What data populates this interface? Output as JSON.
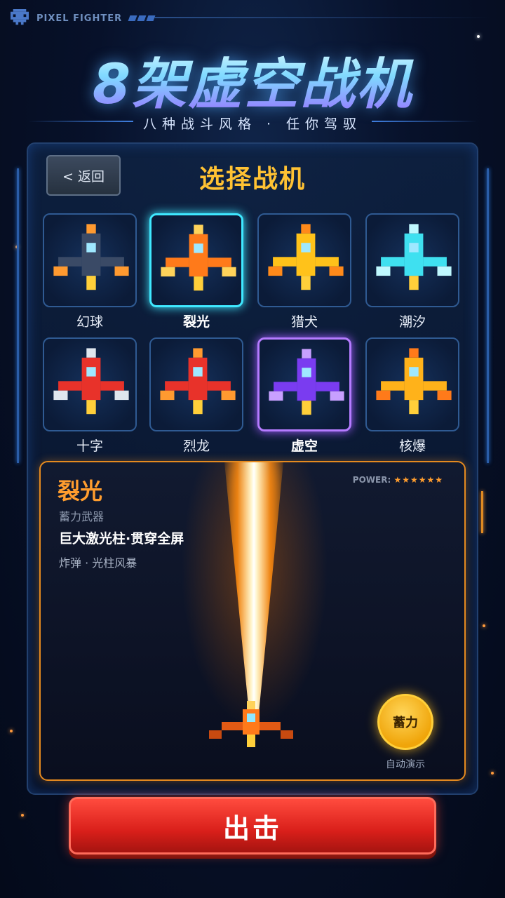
{
  "header": {
    "brand": "PIXEL FIGHTER",
    "title": "8架虚空战机",
    "subtitle": "八种战斗风格 · 任你驾驭"
  },
  "nav": {
    "back_label": "< 返回",
    "page_title": "选择战机"
  },
  "ships": [
    {
      "name": "幻球",
      "color": "#3a4a66",
      "accent": "#ff9a30",
      "state": "normal"
    },
    {
      "name": "裂光",
      "color": "#ff7a1a",
      "accent": "#ffd35a",
      "state": "selected"
    },
    {
      "name": "猎犬",
      "color": "#ffc21a",
      "accent": "#ff8a1a",
      "state": "normal"
    },
    {
      "name": "潮汐",
      "color": "#3fe0f0",
      "accent": "#bff8ff",
      "state": "normal"
    },
    {
      "name": "十字",
      "color": "#e8322a",
      "accent": "#dfe6ee",
      "state": "normal"
    },
    {
      "name": "烈龙",
      "color": "#e8322a",
      "accent": "#ff9a30",
      "state": "normal"
    },
    {
      "name": "虚空",
      "color": "#7a3cf0",
      "accent": "#c8a0ff",
      "state": "highlighted"
    },
    {
      "name": "核爆",
      "color": "#ffb21a",
      "accent": "#ff7a1a",
      "state": "normal"
    }
  ],
  "detail": {
    "name": "裂光",
    "type": "蓄力武器",
    "description": "巨大激光柱·贯穿全屏",
    "skill": "炸弹 · 光柱风暴",
    "power_label": "POWER:",
    "power_stars": "★★★★★★",
    "charge_label": "蓄力",
    "auto_label": "自动演示"
  },
  "action": {
    "fire_label": "出击"
  },
  "colors": {
    "accent_orange": "#ff9d2e",
    "accent_gold": "#ffc233",
    "selection_cyan": "#3fe8ff",
    "selection_purple": "#b57bff",
    "fire_red": "#d91f1a"
  }
}
